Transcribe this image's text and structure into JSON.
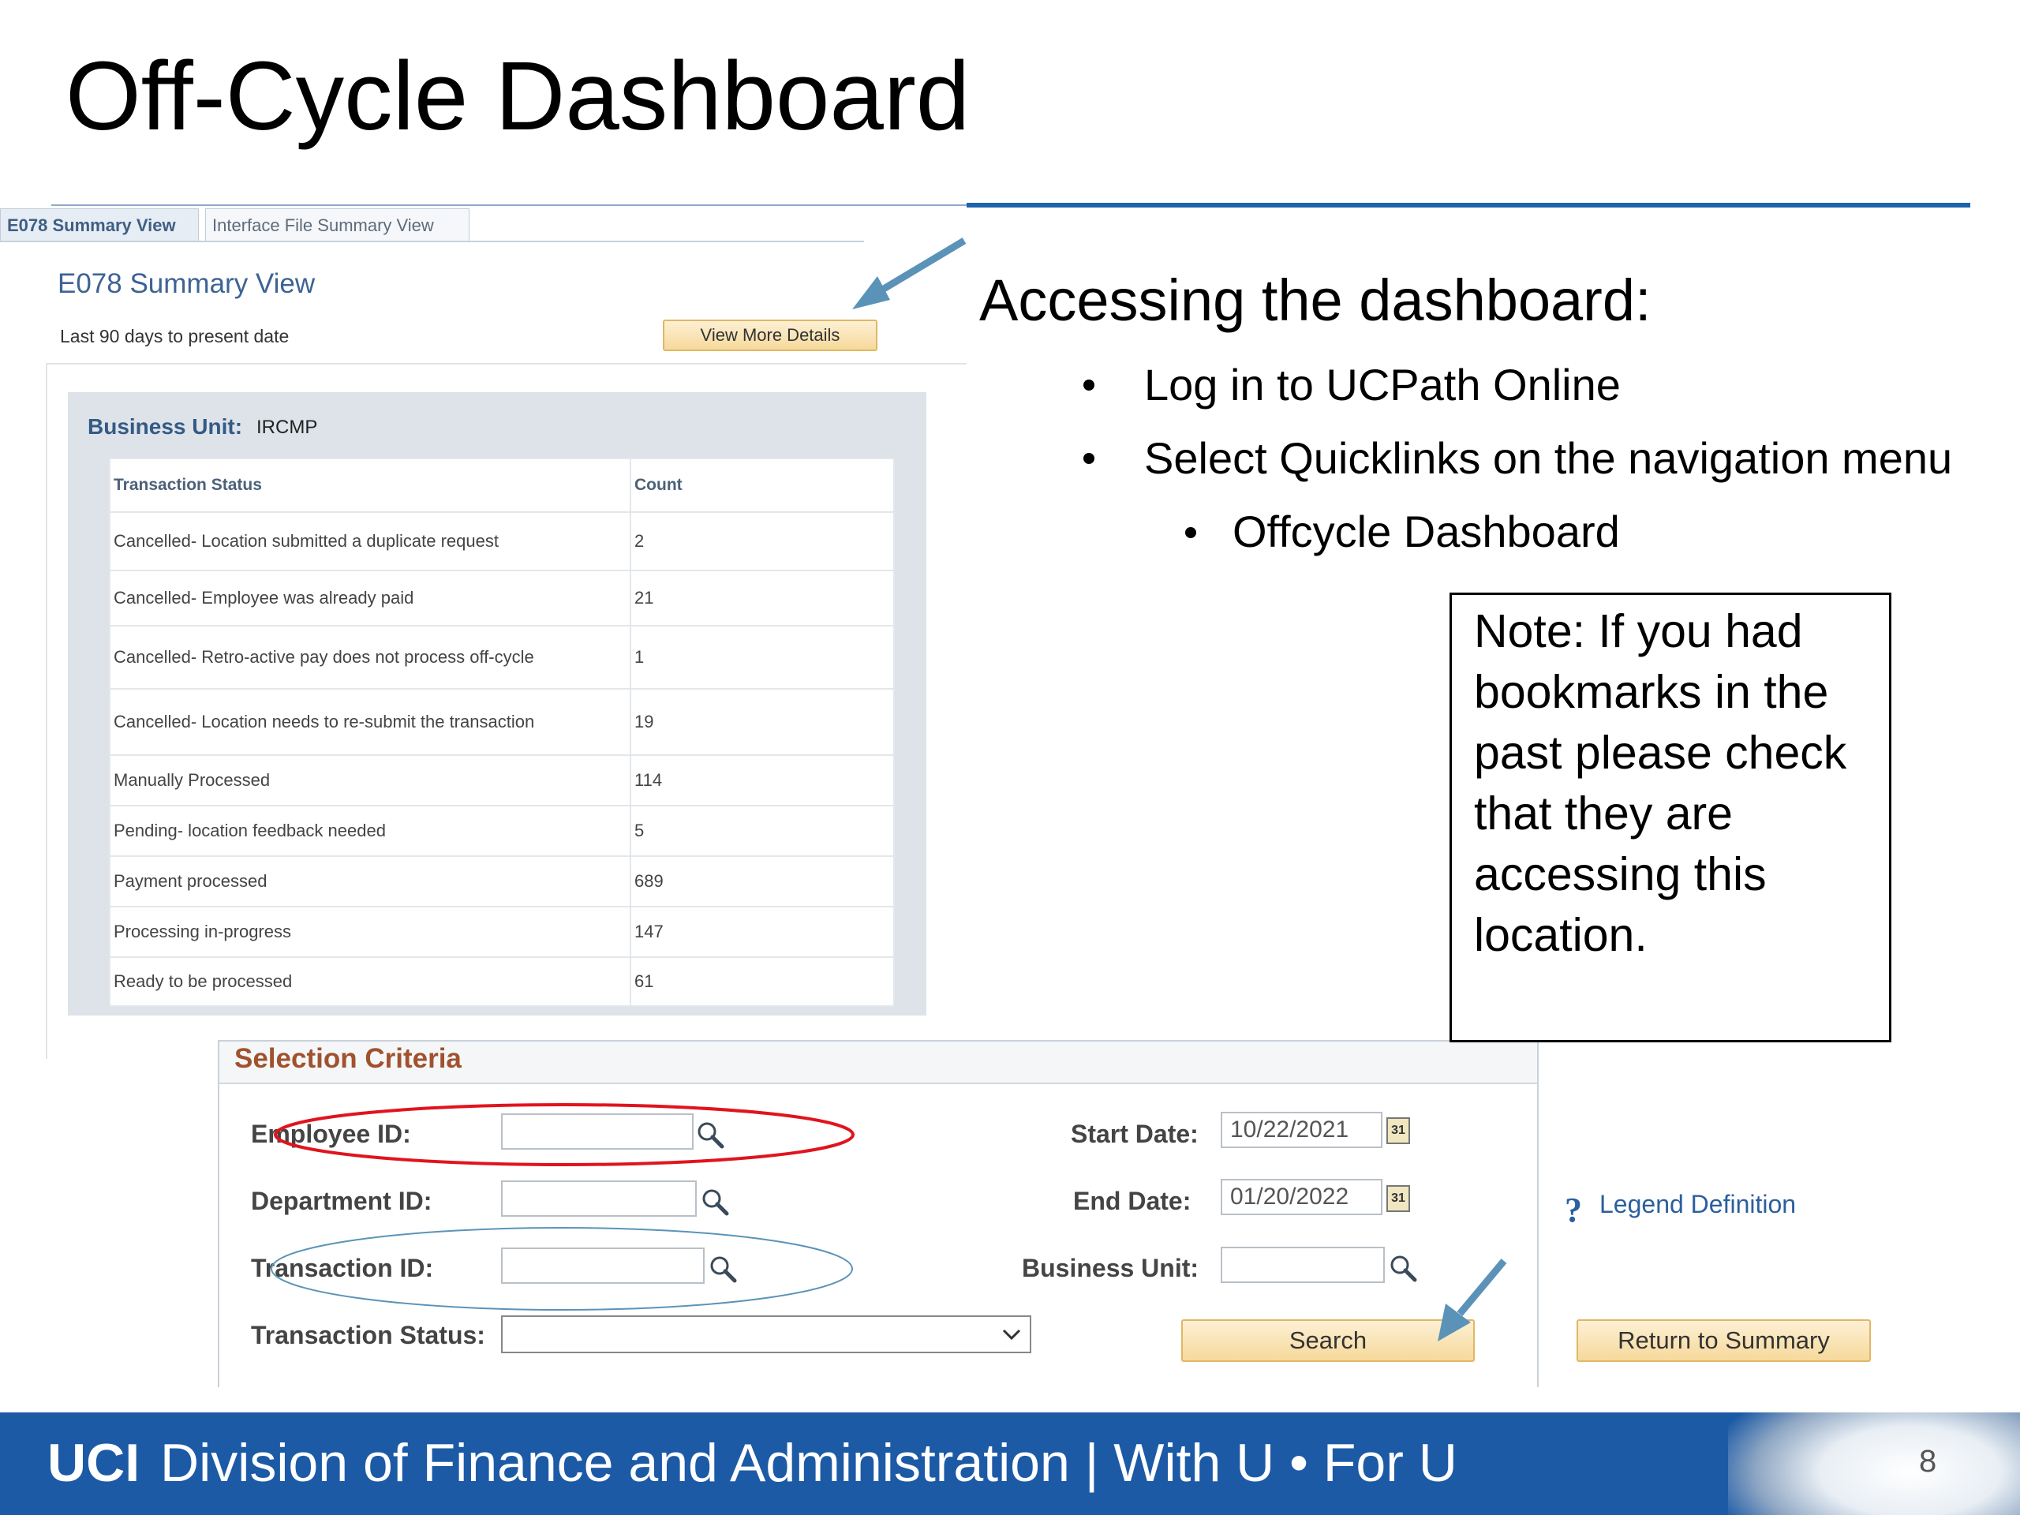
{
  "slide": {
    "title": "Off-Cycle Dashboard",
    "page_number": "8"
  },
  "tabs": [
    {
      "label": "E078 Summary View"
    },
    {
      "label": "Interface File Summary View"
    }
  ],
  "summary": {
    "title": "E078 Summary View",
    "subtitle": "Last 90 days to present date",
    "view_more_label": "View More Details",
    "business_unit_label": "Business Unit:",
    "business_unit_value": "IRCMP",
    "columns": [
      "Transaction Status",
      "Count"
    ],
    "rows": [
      {
        "status": "Cancelled- Location submitted a duplicate request",
        "count": "2"
      },
      {
        "status": "Cancelled- Employee was already paid",
        "count": "21"
      },
      {
        "status": "Cancelled- Retro-active pay does not process off-cycle",
        "count": "1"
      },
      {
        "status": "Cancelled- Location needs to re-submit the transaction",
        "count": "19"
      },
      {
        "status": "Manually Processed",
        "count": "114"
      },
      {
        "status": "Pending- location feedback needed",
        "count": "5"
      },
      {
        "status": "Payment processed",
        "count": "689"
      },
      {
        "status": "Processing in-progress",
        "count": "147"
      },
      {
        "status": "Ready to be processed",
        "count": "61"
      }
    ]
  },
  "selection": {
    "title": "Selection Criteria",
    "employee_id_label": "Employee ID:",
    "department_id_label": "Department ID:",
    "transaction_id_label": "Transaction ID:",
    "transaction_status_label": "Transaction Status:",
    "start_date_label": "Start Date:",
    "start_date_value": "10/22/2021",
    "end_date_label": "End Date:",
    "end_date_value": "01/20/2022",
    "business_unit_label": "Business Unit:",
    "search_label": "Search",
    "return_label": "Return to Summary",
    "legend_label": "Legend Definition",
    "calendar_glyph": "31"
  },
  "instructions": {
    "heading": "Accessing the dashboard:",
    "bullets": [
      "Log in to UCPath Online",
      "Select Quicklinks on the navigation menu"
    ],
    "sub_bullet": "Offcycle Dashboard",
    "note": "Note: If you had bookmarks in the past please check that they are accessing this location."
  },
  "footer": {
    "brand": "UCI",
    "text": "Division of Finance and Administration | With U • For U"
  },
  "colors": {
    "footer_bg": "#1c5aa6",
    "arrow": "#5b93b8",
    "highlight_red": "#e0141e",
    "highlight_blue": "#5b93b8",
    "link": "#2b5f9e"
  }
}
